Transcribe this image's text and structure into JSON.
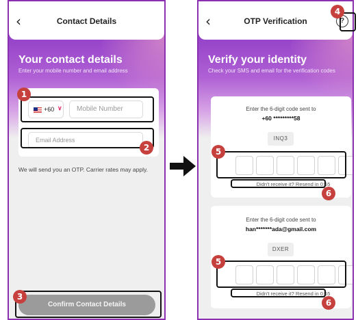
{
  "left_screen": {
    "header": {
      "back_icon": "chevron-left-icon",
      "title": "Contact Details"
    },
    "heading": "Your contact details",
    "subheading": "Enter your mobile number and email address",
    "country_code": "+60",
    "country_flag_icon": "malaysia-flag-icon",
    "mobile_placeholder": "Mobile Number",
    "email_placeholder": "Email Address",
    "otp_note": "We will send you an OTP. Carrier rates may apply.",
    "confirm_button": "Confirm Contact Details"
  },
  "right_screen": {
    "header": {
      "back_icon": "chevron-left-icon",
      "title": "OTP Verification",
      "help_icon": "question-circle-icon",
      "help_glyph": "?"
    },
    "heading": "Verify your identity",
    "subheading": "Check your SMS and email for the verification codes",
    "sms_card": {
      "prompt": "Enter the 6-digit code sent to",
      "recipient": "+60 *********58",
      "captcha": "INQ3",
      "resend": "Didn't receive it?  Resend in 0:55"
    },
    "email_card": {
      "prompt": "Enter the 6-digit code sent to",
      "recipient": "han*******ada@gmail.com",
      "captcha": "DXER",
      "resend": "Didn't receive it?  Resend in 0:55"
    }
  },
  "annotations": {
    "badge_1": "1",
    "badge_2": "2",
    "badge_3": "3",
    "badge_4": "4",
    "badge_5a": "5",
    "badge_5b": "5",
    "badge_6a": "6",
    "badge_6b": "6"
  },
  "colors": {
    "brand_purple": "#8f3cc6",
    "badge_red": "#c6413d",
    "chevron_pink": "#e0245e",
    "disabled_button": "#9b9b9b"
  }
}
